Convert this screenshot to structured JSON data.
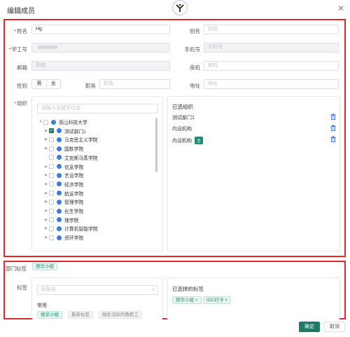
{
  "dialog": {
    "title": "编辑成员",
    "close_icon": "close-icon",
    "logo_icon": "app-logo"
  },
  "form": {
    "name": {
      "label": "姓名",
      "value": "Hg"
    },
    "alias": {
      "label": "别名",
      "placeholder": "别名"
    },
    "staff_no": {
      "label": "学工号"
    },
    "phone": {
      "label": "手机号",
      "placeholder": "手机号"
    },
    "email": {
      "label": "邮箱",
      "placeholder": "邮箱"
    },
    "landline": {
      "label": "座机",
      "placeholder": "座机"
    },
    "gender": {
      "label": "性别",
      "options": [
        "男",
        "女"
      ]
    },
    "position": {
      "label": "职务",
      "placeholder": "职务"
    },
    "address": {
      "label": "地址",
      "placeholder": "地址"
    },
    "org": {
      "label": "组织",
      "search_placeholder": "请输入关键字过滤",
      "tree": [
        {
          "label": "莞山科技大学",
          "level": 0,
          "expander": "▼",
          "checkbox": "none"
        },
        {
          "label": "测试部门1",
          "level": 1,
          "expander": "▶",
          "checkbox": "checked"
        },
        {
          "label": "马克思主义学院",
          "level": 1,
          "expander": "▶",
          "checkbox": "empty"
        },
        {
          "label": "国数学院",
          "level": 1,
          "expander": "▶",
          "checkbox": "empty"
        },
        {
          "label": "艾克斯马蒸学院",
          "level": 1,
          "expander": "",
          "checkbox": "empty"
        },
        {
          "label": "信息学院",
          "level": 1,
          "expander": "▶",
          "checkbox": "empty"
        },
        {
          "label": "艺设学院",
          "level": 1,
          "expander": "▶",
          "checkbox": "empty"
        },
        {
          "label": "经济学院",
          "level": 1,
          "expander": "▶",
          "checkbox": "empty"
        },
        {
          "label": "航运学院",
          "level": 1,
          "expander": "▶",
          "checkbox": "empty"
        },
        {
          "label": "管理学院",
          "level": 1,
          "expander": "▶",
          "checkbox": "empty"
        },
        {
          "label": "化生学院",
          "level": 1,
          "expander": "▶",
          "checkbox": "empty"
        },
        {
          "label": "理学院",
          "level": 1,
          "expander": "▶",
          "checkbox": "empty"
        },
        {
          "label": "计算机智能学院",
          "level": 1,
          "expander": "▶",
          "checkbox": "empty"
        },
        {
          "label": "资环学院",
          "level": 1,
          "expander": "▶",
          "checkbox": "empty"
        }
      ],
      "selected_title": "已选组织",
      "selected": [
        {
          "label": "测试部门1",
          "main": ""
        },
        {
          "label": "内设机构",
          "main": ""
        },
        {
          "label": "内设机构",
          "main": "主"
        }
      ]
    }
  },
  "dept_tags": {
    "label": "部门标签",
    "tags": [
      "德华小组"
    ]
  },
  "tags": {
    "label": "标签",
    "search_placeholder": "标签名",
    "common_label": "常用",
    "common": [
      "德华小组",
      "最新标签",
      "随处活跃的教职工"
    ],
    "selected_title": "已选择的标签",
    "selected": [
      "德华小组",
      "IOC打卡"
    ]
  },
  "footer": {
    "confirm": "确定",
    "cancel": "取消"
  },
  "colors": {
    "accent": "#1f7a68",
    "highlight_border": "#e02b2b"
  }
}
